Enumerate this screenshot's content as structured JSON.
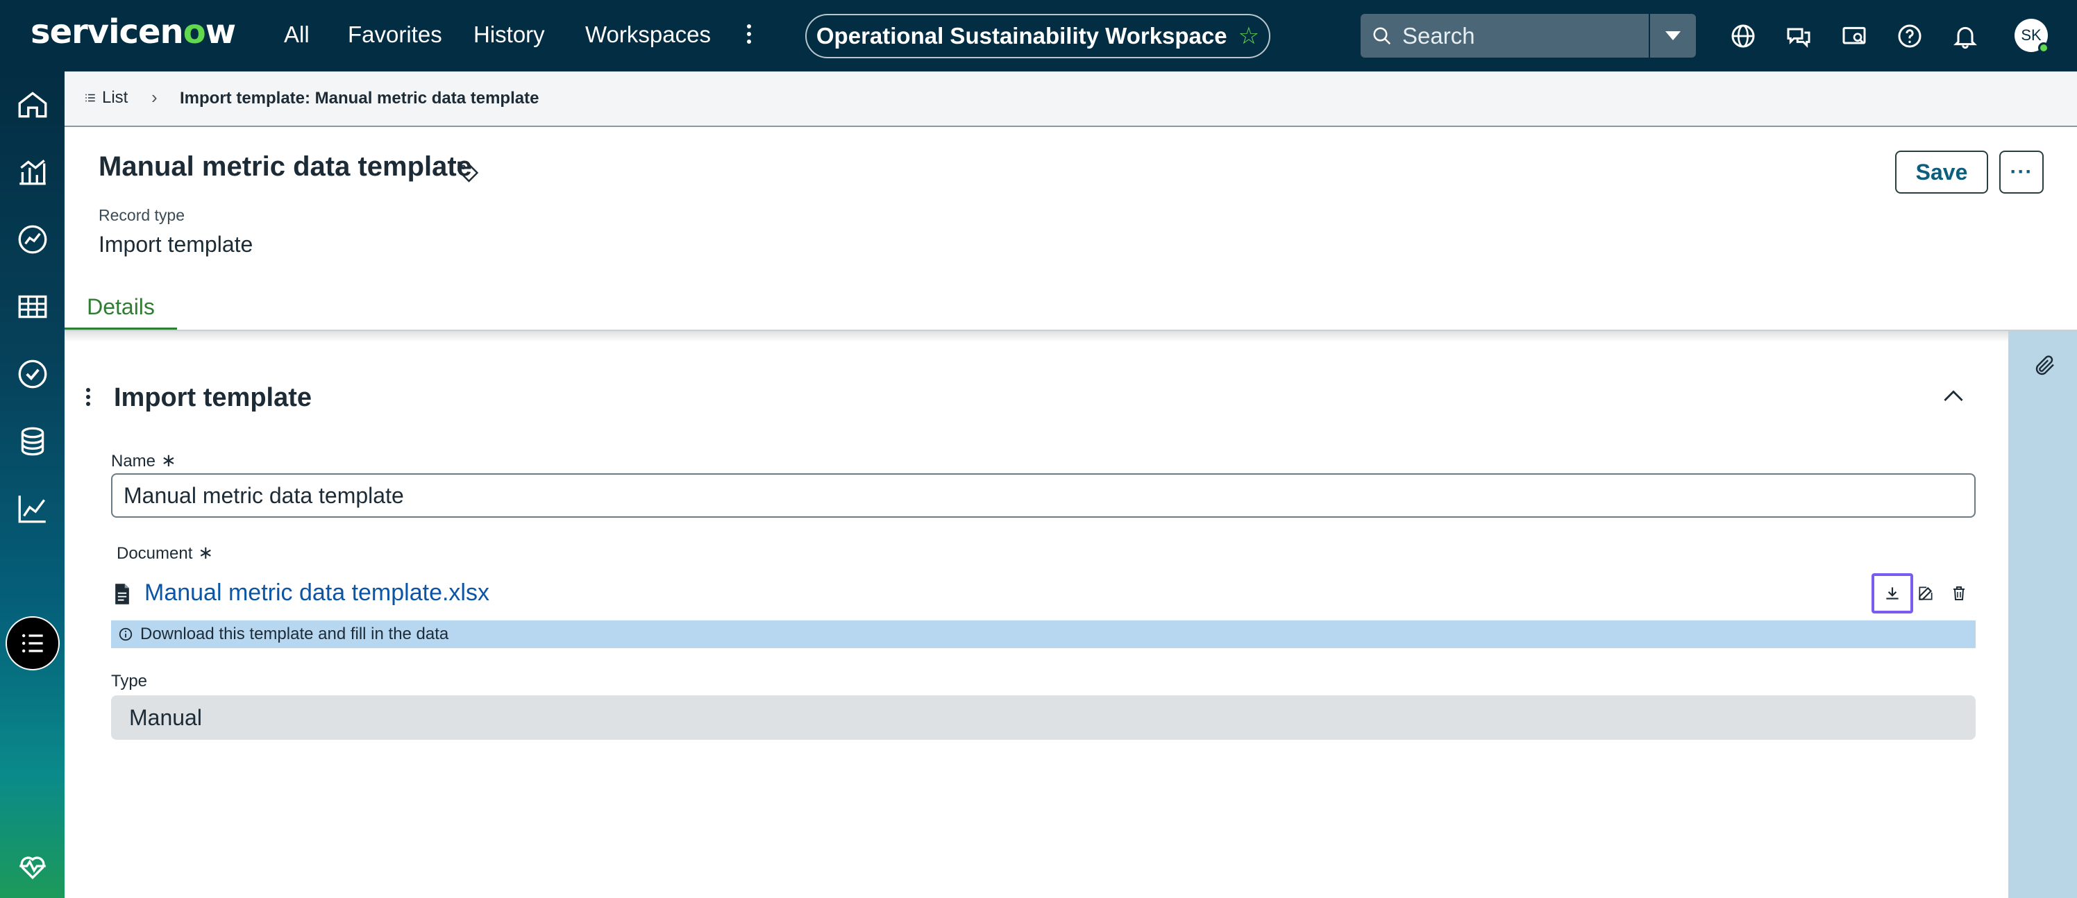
{
  "nav": {
    "logo_left": "servicen",
    "logo_o": "o",
    "logo_right": "w",
    "links": [
      "All",
      "Favorites",
      "History",
      "Workspaces"
    ],
    "workspace": "Operational Sustainability Workspace",
    "search_placeholder": "Search",
    "avatar": "SK"
  },
  "breadcrumb": {
    "list": "List",
    "current": "Import template: Manual metric data template"
  },
  "record": {
    "title": "Manual metric data template",
    "type_label": "Record type",
    "type_value": "Import template",
    "save_label": "Save"
  },
  "tabs": [
    "Details"
  ],
  "section": {
    "title": "Import template",
    "name_label": "Name",
    "name_value": "Manual metric data template",
    "document_label": "Document",
    "document_file": "Manual metric data template.xlsx",
    "document_hint": "Download this template and fill in the data",
    "type_label": "Type",
    "type_value": "Manual"
  },
  "colors": {
    "nav_bg": "#032d42",
    "accent_green": "#62d84e",
    "link_blue": "#0b55a6",
    "focus_ring": "#7b5cf0",
    "info_bg": "#b7d6ef"
  }
}
